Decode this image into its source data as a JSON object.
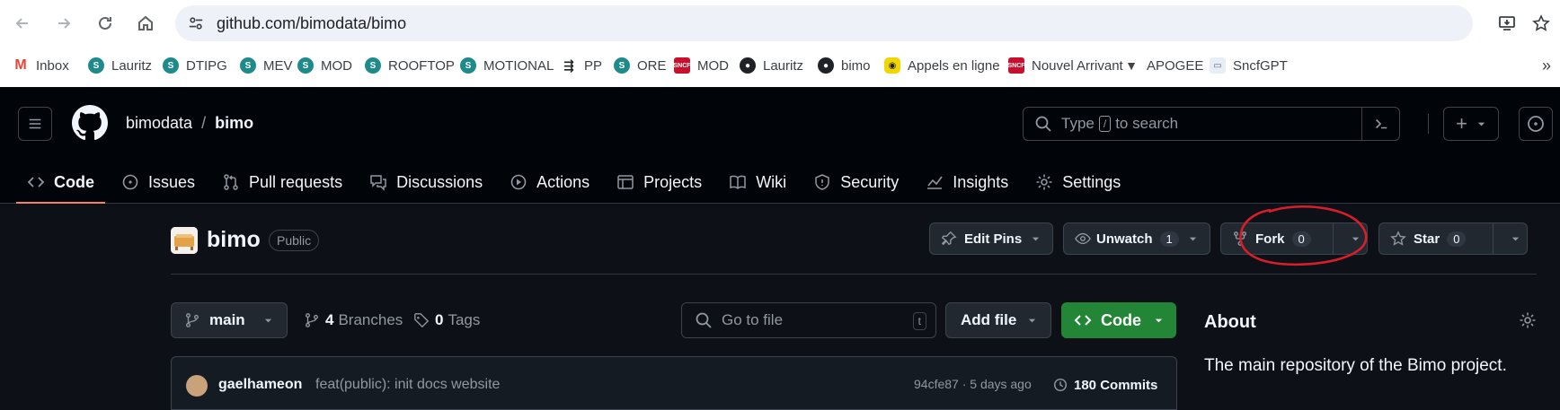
{
  "browser": {
    "url": "github.com/bimodata/bimo",
    "bookmarks": [
      {
        "label": "Inbox",
        "icon": "gmail-icon",
        "glyph": "M",
        "kind": "gmail"
      },
      {
        "label": "Lauritz",
        "icon": "s-icon",
        "glyph": "S",
        "kind": "s"
      },
      {
        "label": "DTIPG",
        "icon": "s-icon",
        "glyph": "S",
        "kind": "s"
      },
      {
        "label": "MEV",
        "icon": "s-icon",
        "glyph": "S",
        "kind": "s"
      },
      {
        "label": "MOD",
        "icon": "s-icon",
        "glyph": "S",
        "kind": "s"
      },
      {
        "label": "ROOFTOP",
        "icon": "s-icon",
        "glyph": "S",
        "kind": "s"
      },
      {
        "label": "MOTIONAL",
        "icon": "s-icon",
        "glyph": "S",
        "kind": "s"
      },
      {
        "label": "PP",
        "icon": "pp-icon",
        "glyph": "⇶",
        "kind": "pp"
      },
      {
        "label": "ORE",
        "icon": "s-icon",
        "glyph": "S",
        "kind": "s"
      },
      {
        "label": "MOD",
        "icon": "sncf-icon",
        "glyph": "SNCF",
        "kind": "sncf"
      },
      {
        "label": "Lauritz",
        "icon": "github-icon",
        "glyph": "●",
        "kind": "gh"
      },
      {
        "label": "bimo",
        "icon": "github-icon",
        "glyph": "●",
        "kind": "gh"
      },
      {
        "label": "Appels en ligne",
        "icon": "appels-icon",
        "glyph": "◉",
        "kind": "appels"
      },
      {
        "label": "Nouvel Arrivant",
        "icon": "sncf-icon",
        "glyph": "SNCF",
        "kind": "sncf"
      },
      {
        "label": "APOGEE",
        "icon": "apogee-icon",
        "glyph": "▼",
        "kind": "apogee"
      },
      {
        "label": "SncfGPT",
        "icon": "gpt-icon",
        "glyph": "▭",
        "kind": "gpt"
      }
    ],
    "more_glyph": "»"
  },
  "header": {
    "owner": "bimodata",
    "separator": "/",
    "repo": "bimo",
    "search": {
      "prefix": "Type",
      "slash": "/",
      "suffix": "to search"
    },
    "plus_glyph": "+"
  },
  "tabs": [
    {
      "label": "Code",
      "icon": "code-icon",
      "active": true
    },
    {
      "label": "Issues",
      "icon": "issue-icon"
    },
    {
      "label": "Pull requests",
      "icon": "pull-request-icon"
    },
    {
      "label": "Discussions",
      "icon": "discussions-icon"
    },
    {
      "label": "Actions",
      "icon": "actions-icon"
    },
    {
      "label": "Projects",
      "icon": "projects-icon"
    },
    {
      "label": "Wiki",
      "icon": "wiki-icon"
    },
    {
      "label": "Security",
      "icon": "security-icon"
    },
    {
      "label": "Insights",
      "icon": "insights-icon"
    },
    {
      "label": "Settings",
      "icon": "settings-icon"
    }
  ],
  "repo": {
    "name": "bimo",
    "visibility": "Public",
    "edit_pins": "Edit Pins",
    "unwatch": "Unwatch",
    "watch_count": "1",
    "fork": "Fork",
    "fork_count": "0",
    "star": "Star",
    "star_count": "0"
  },
  "toolbar": {
    "branch": "main",
    "branches_count": "4",
    "branches_label": "Branches",
    "tags_count": "0",
    "tags_label": "Tags",
    "goto_placeholder": "Go to file",
    "goto_kbd": "t",
    "add_file": "Add file",
    "code": "Code"
  },
  "about": {
    "title": "About",
    "description": "The main repository of the Bimo project."
  },
  "commit": {
    "author": "gaelhameon",
    "message": "feat(public): init docs website",
    "hash": "94cfe87 · 5 days ago",
    "count": "180 Commits"
  },
  "colors": {
    "accent_underline": "#f78166",
    "code_button": "#238636",
    "annotation": "#d81e2a"
  }
}
